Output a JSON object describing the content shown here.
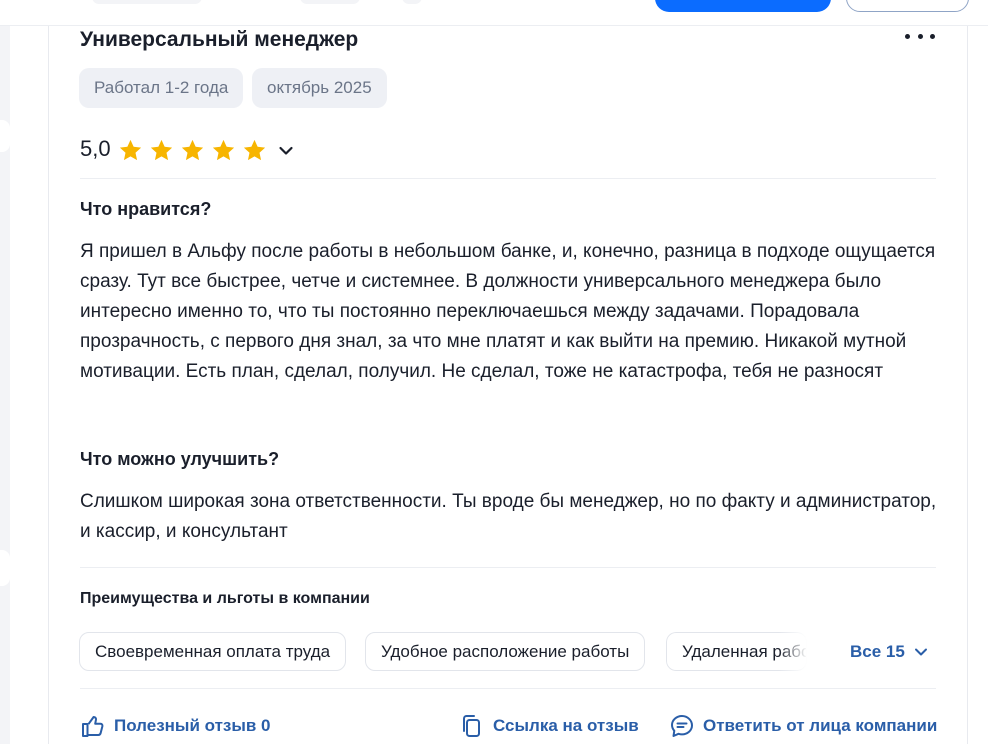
{
  "review": {
    "job_title": "Универсальный менеджер",
    "tags": [
      "Работал 1-2 года",
      "октябрь 2025"
    ],
    "rating": "5,0",
    "stars": 5,
    "likes_heading": "Что нравится?",
    "likes_text": "Я пришел в Альфу после работы в небольшом банке, и, конечно, разница в подходе ощущается сразу. Тут все быстрее, четче и системнее. В должности универсального менеджера было интересно именно то, что ты постоянно переключаешься между задачами. Порадовала прозрачность, с первого дня знал, за что мне платят и как выйти на премию. Никакой мутной мотивации. Есть план, сделал, получил. Не сделал, тоже не катастрофа, тебя не разносят",
    "improve_heading": "Что можно улучшить?",
    "improve_text": "Слишком широкая зона ответственности. Ты вроде бы менеджер, но по факту и администратор, и кассир, и консультант"
  },
  "benefits": {
    "title": "Преимущества и льготы в компании",
    "items": [
      "Своевременная оплата труда",
      "Удобное расположение работы",
      "Удаленная работа"
    ],
    "all_label": "Все 15"
  },
  "actions": {
    "helpful": "Полезный отзыв 0",
    "link": "Ссылка на отзыв",
    "reply": "Ответить от лица компании"
  },
  "colors": {
    "accent": "#0b6cff",
    "link": "#2a5ea8",
    "star": "#f7b500",
    "chip_bg": "#eef0f5"
  }
}
